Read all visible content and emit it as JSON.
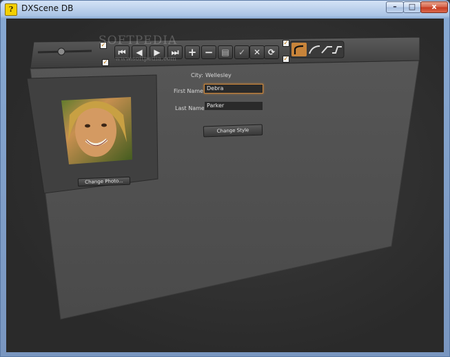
{
  "window": {
    "title": "DXScene DB",
    "icon": "dxscene-app-icon",
    "minimize_label": "–",
    "maximize_label": "□",
    "close_label": "x"
  },
  "toolbar": {
    "zoom_slider_value": 0.45,
    "check_top": true,
    "check_bottom": true,
    "nav_first": "⏮",
    "nav_prev": "◀",
    "nav_next": "▶",
    "nav_last": "⏭",
    "add": "+",
    "remove": "−",
    "edit": "▤",
    "post": "✓",
    "cancel": "✕",
    "refresh": "⟳",
    "style_check_top": true,
    "style_check_bottom": true,
    "curve_icons": [
      "curve-1-icon",
      "curve-2-icon",
      "curve-3-icon",
      "curve-4-icon"
    ],
    "selected_curve": 0
  },
  "watermark": {
    "brand": "SOFTPEDIA",
    "url": "www.softpedia.com"
  },
  "form": {
    "city_label": "City:",
    "city_value": "Wellesley",
    "first_name_label": "First Name:",
    "first_name_value": "Debra",
    "last_name_label": "Last Name:",
    "last_name_value": "Parker",
    "change_style_label": "Change Style"
  },
  "photo": {
    "change_photo_label": "Change Photo..."
  },
  "colors": {
    "accent": "#c8843a",
    "panel": "#4a4a4a",
    "background": "#2e2e2e"
  }
}
